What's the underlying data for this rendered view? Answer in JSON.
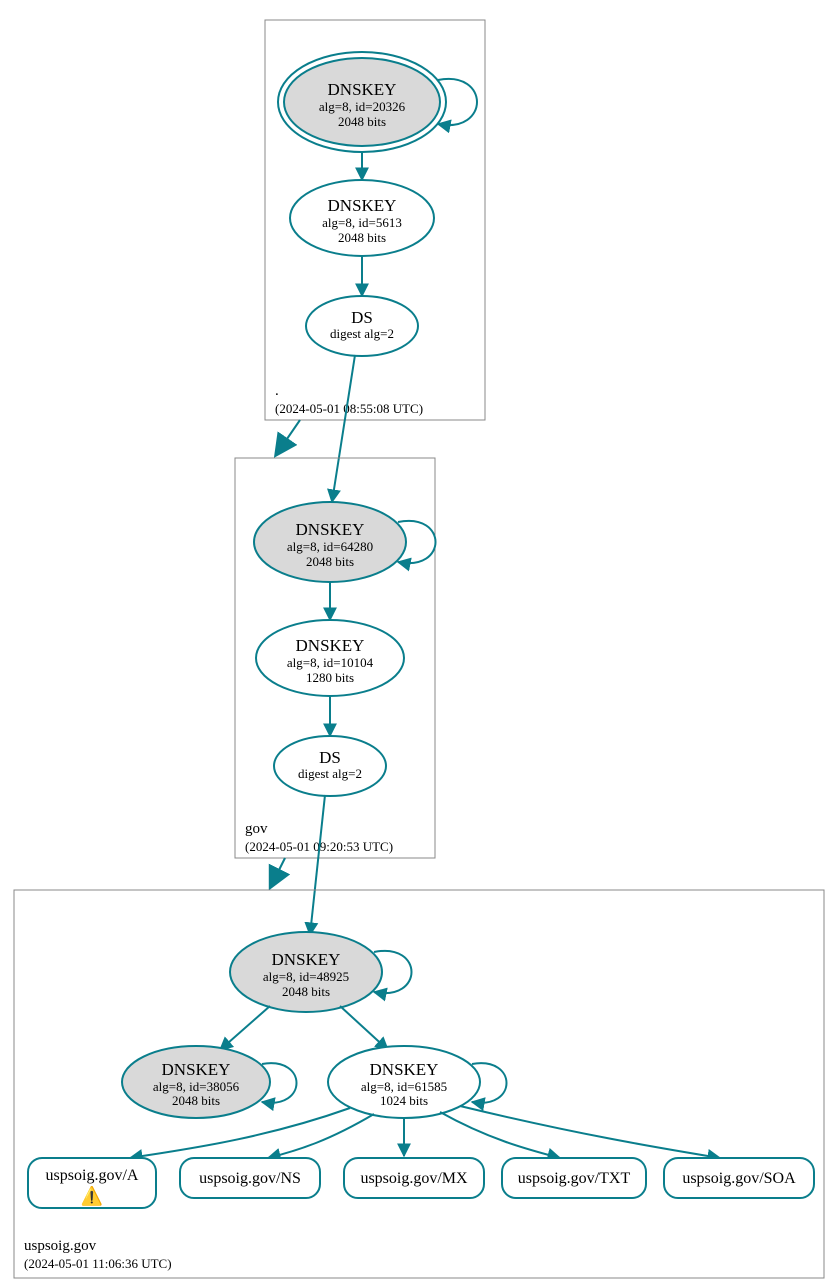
{
  "colors": {
    "stroke": "#0a7e8c",
    "fill_gray": "#d9d9d9"
  },
  "zones": [
    {
      "name": ".",
      "timestamp": "(2024-05-01 08:55:08 UTC)",
      "nodes": [
        {
          "id": "root-ksk",
          "title": "DNSKEY",
          "line1": "alg=8, id=20326",
          "line2": "2048 bits",
          "filled": true,
          "double": true
        },
        {
          "id": "root-zsk",
          "title": "DNSKEY",
          "line1": "alg=8, id=5613",
          "line2": "2048 bits",
          "filled": false
        },
        {
          "id": "root-ds",
          "title": "DS",
          "line1": "digest alg=2",
          "line2": "",
          "filled": false
        }
      ]
    },
    {
      "name": "gov",
      "timestamp": "(2024-05-01 09:20:53 UTC)",
      "nodes": [
        {
          "id": "gov-ksk",
          "title": "DNSKEY",
          "line1": "alg=8, id=64280",
          "line2": "2048 bits",
          "filled": true
        },
        {
          "id": "gov-zsk",
          "title": "DNSKEY",
          "line1": "alg=8, id=10104",
          "line2": "1280 bits",
          "filled": false
        },
        {
          "id": "gov-ds",
          "title": "DS",
          "line1": "digest alg=2",
          "line2": "",
          "filled": false
        }
      ]
    },
    {
      "name": "uspsoig.gov",
      "timestamp": "(2024-05-01 11:06:36 UTC)",
      "nodes": [
        {
          "id": "usp-ksk",
          "title": "DNSKEY",
          "line1": "alg=8, id=48925",
          "line2": "2048 bits",
          "filled": true
        },
        {
          "id": "usp-zsk2",
          "title": "DNSKEY",
          "line1": "alg=8, id=38056",
          "line2": "2048 bits",
          "filled": true
        },
        {
          "id": "usp-zsk",
          "title": "DNSKEY",
          "line1": "alg=8, id=61585",
          "line2": "1024 bits",
          "filled": false
        }
      ],
      "rrsets": [
        {
          "id": "rr-a",
          "label": "uspsoig.gov/A",
          "warning": true
        },
        {
          "id": "rr-ns",
          "label": "uspsoig.gov/NS",
          "warning": false
        },
        {
          "id": "rr-mx",
          "label": "uspsoig.gov/MX",
          "warning": false
        },
        {
          "id": "rr-txt",
          "label": "uspsoig.gov/TXT",
          "warning": false
        },
        {
          "id": "rr-soa",
          "label": "uspsoig.gov/SOA",
          "warning": false
        }
      ]
    }
  ],
  "edges": [
    {
      "from": "root-ksk",
      "to": "root-ksk",
      "self": true
    },
    {
      "from": "root-ksk",
      "to": "root-zsk"
    },
    {
      "from": "root-zsk",
      "to": "root-ds"
    },
    {
      "from": "root-ds",
      "to": "gov-ksk"
    },
    {
      "from": "gov-ksk",
      "to": "gov-ksk",
      "self": true
    },
    {
      "from": "gov-ksk",
      "to": "gov-zsk"
    },
    {
      "from": "gov-zsk",
      "to": "gov-ds"
    },
    {
      "from": "gov-ds",
      "to": "usp-ksk"
    },
    {
      "from": "usp-ksk",
      "to": "usp-ksk",
      "self": true
    },
    {
      "from": "usp-ksk",
      "to": "usp-zsk2"
    },
    {
      "from": "usp-ksk",
      "to": "usp-zsk"
    },
    {
      "from": "usp-zsk2",
      "to": "usp-zsk2",
      "self": true
    },
    {
      "from": "usp-zsk",
      "to": "usp-zsk",
      "self": true
    },
    {
      "from": "usp-zsk",
      "to": "rr-a"
    },
    {
      "from": "usp-zsk",
      "to": "rr-ns"
    },
    {
      "from": "usp-zsk",
      "to": "rr-mx"
    },
    {
      "from": "usp-zsk",
      "to": "rr-txt"
    },
    {
      "from": "usp-zsk",
      "to": "rr-soa"
    }
  ]
}
